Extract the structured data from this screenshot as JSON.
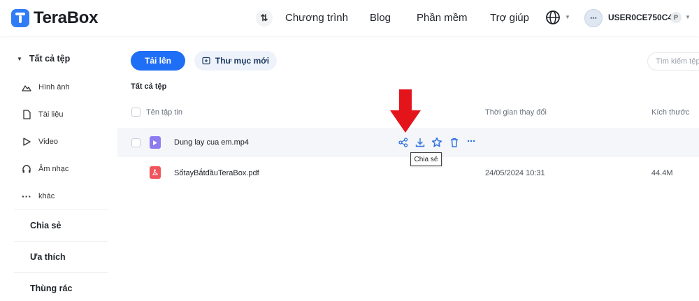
{
  "header": {
    "logo": "TeraBox",
    "nav": [
      "Chương trình",
      "Blog",
      "Phần mềm",
      "Trợ giúp"
    ],
    "sort_glyph": "⇅",
    "avatar_glyph": "•••",
    "username": "USER0CE750C4",
    "badge": "P"
  },
  "sidebar": {
    "all_files": "Tất cả tệp",
    "items": [
      {
        "label": "Hình ảnh",
        "icon": "image-icon"
      },
      {
        "label": "Tài liệu",
        "icon": "document-icon"
      },
      {
        "label": "Video",
        "icon": "play-icon"
      },
      {
        "label": "Âm nhạc",
        "icon": "headphones-icon"
      },
      {
        "label": "khác",
        "icon": "more-icon"
      }
    ],
    "sections": [
      "Chia sẻ",
      "Ưa thích",
      "Thùng rác"
    ]
  },
  "toolbar": {
    "upload": "Tải lên",
    "new_folder": "Thư mục mới",
    "search_placeholder": "Tìm kiếm tệp"
  },
  "main": {
    "breadcrumb": "Tất cả tệp",
    "columns": {
      "name": "Tên tập tin",
      "modified": "Thời gian thay đổi",
      "size": "Kích thước"
    },
    "files": [
      {
        "name": "Dung lay cua em.mp4",
        "modified": "",
        "size": "",
        "type": "video"
      },
      {
        "name": "SổtayBắtđầuTeraBox.pdf",
        "modified": "24/05/2024 10:31",
        "size": "44.4M",
        "type": "pdf"
      }
    ],
    "more_glyph": "···",
    "tooltip": "Chia sẻ"
  },
  "colors": {
    "accent": "#1f6ef6",
    "arrow": "#e4141b",
    "video_icon": "#8c7cf0",
    "pdf_icon": "#f0555b"
  }
}
